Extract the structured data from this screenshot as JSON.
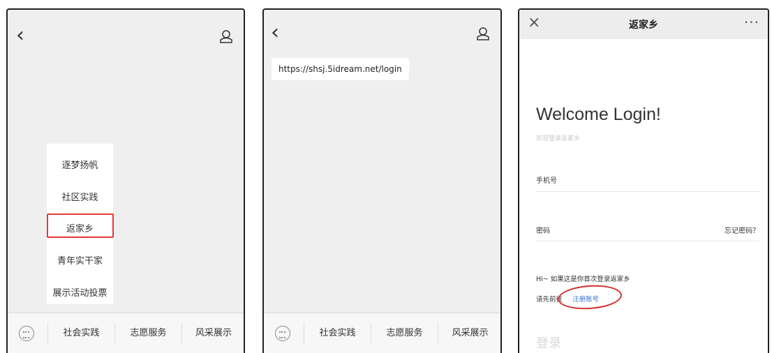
{
  "panel1": {
    "menu_items": [
      "逐梦扬帆",
      "社区实践",
      "返家乡",
      "青年实干家",
      "展示活动投票"
    ],
    "highlighted_item": "返家乡",
    "nav": [
      "社会实践",
      "志愿服务",
      "风采展示"
    ]
  },
  "panel2": {
    "url": "https://shsj.5idream.net/login",
    "nav": [
      "社会实践",
      "志愿服务",
      "风采展示"
    ]
  },
  "panel3": {
    "header_title": "返家乡",
    "close_glyph": "×",
    "more_glyph": "···",
    "welcome": "Welcome Login!",
    "welcome_sub": "欢迎登录返家乡",
    "phone_label": "手机号",
    "password_label": "密码",
    "forgot_label": "忘记密码？",
    "hi_text": "Hi~ 如果这是你首次登录返家乡",
    "register_prefix": "请先前往",
    "register_link": "注册账号",
    "login_label": "登录"
  },
  "icons": [
    "back-icon",
    "user-icon",
    "keyboard-icon",
    "close-icon",
    "more-icon"
  ],
  "colors": {
    "highlight_red": "#e53935",
    "link_blue": "#3b6fd8"
  }
}
